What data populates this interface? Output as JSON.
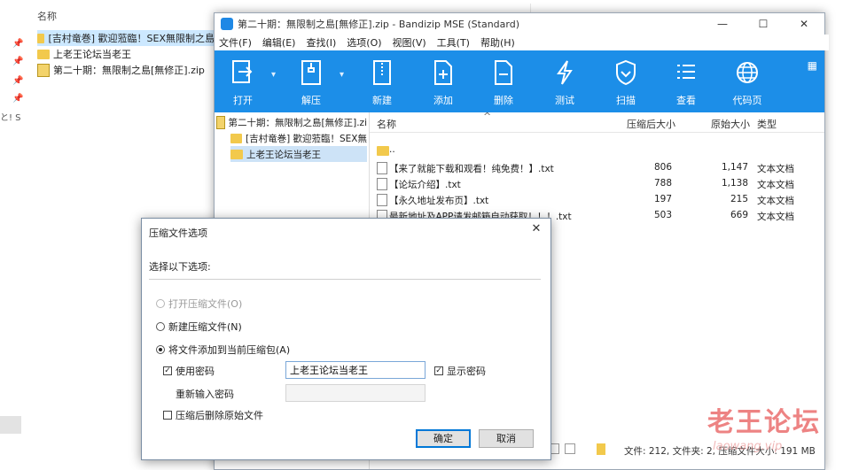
{
  "explorer": {
    "header": "名称",
    "items": [
      {
        "name": "[吉村竜巻] 歡迎蒞臨！SEX無限制之島",
        "type": "folder"
      },
      {
        "name": "上老王论坛当老王",
        "type": "folder"
      },
      {
        "name": "第二十期：無限制之島[無修正].zip",
        "type": "zip"
      }
    ],
    "side_text": "と! S"
  },
  "bandizip": {
    "title": "第二十期：無限制之島[無修正].zip - Bandizip MSE (Standard)",
    "menu": [
      "文件(F)",
      "编辑(E)",
      "查找(I)",
      "选项(O)",
      "视图(V)",
      "工具(T)",
      "帮助(H)"
    ],
    "toolbar": [
      {
        "label": "打开",
        "icon": "open-icon"
      },
      {
        "label": "解压",
        "icon": "extract-icon"
      },
      {
        "label": "新建",
        "icon": "new-archive-icon"
      },
      {
        "label": "添加",
        "icon": "add-file-icon"
      },
      {
        "label": "删除",
        "icon": "delete-file-icon"
      },
      {
        "label": "测试",
        "icon": "test-bolt-icon"
      },
      {
        "label": "扫描",
        "icon": "scan-shield-icon"
      },
      {
        "label": "查看",
        "icon": "view-list-icon"
      },
      {
        "label": "代码页",
        "icon": "codepage-globe-icon"
      }
    ],
    "tree": [
      {
        "name": "第二十期：無限制之島[無修正].zi",
        "level": 0,
        "type": "zip"
      },
      {
        "name": "[吉村竜巻] 歡迎蒞臨！SEX無",
        "level": 1,
        "type": "folder"
      },
      {
        "name": "上老王论坛当老王",
        "level": 1,
        "type": "folder",
        "selected": true
      }
    ],
    "columns": {
      "name": "名称",
      "packed": "压缩后大小",
      "original": "原始大小",
      "type": "类型"
    },
    "files": [
      {
        "name": "..",
        "packed": "",
        "original": "",
        "type": "",
        "kind": "up"
      },
      {
        "name": "【来了就能下载和观看！纯免费！】.txt",
        "packed": "806",
        "original": "1,147",
        "type": "文本文档",
        "kind": "txt"
      },
      {
        "name": "【论坛介绍】.txt",
        "packed": "788",
        "original": "1,138",
        "type": "文本文档",
        "kind": "txt"
      },
      {
        "name": "【永久地址发布页】.txt",
        "packed": "197",
        "original": "215",
        "type": "文本文档",
        "kind": "txt"
      },
      {
        "name": "最新地址及APP请发邮箱自动获取！！！.txt",
        "packed": "503",
        "original": "669",
        "type": "文本文档",
        "kind": "txt"
      }
    ],
    "status": "文件: 212, 文件夹: 2, 压缩文件大小: 191 MB"
  },
  "dialog": {
    "title": "压缩文件选项",
    "prompt": "选择以下选项:",
    "options": [
      {
        "label": "打开压缩文件(O)",
        "checked": false,
        "disabled": true
      },
      {
        "label": "新建压缩文件(N)",
        "checked": false,
        "disabled": false
      },
      {
        "label": "将文件添加到当前压缩包(A)",
        "checked": true,
        "disabled": false
      }
    ],
    "use_password": {
      "label": "使用密码",
      "checked": true
    },
    "password_value": "上老王论坛当老王",
    "show_password": {
      "label": "显示密码",
      "checked": true
    },
    "reenter_label": "重新输入密码",
    "delete_after": {
      "label": "压缩后删除原始文件",
      "checked": false
    },
    "ok": "确定",
    "cancel": "取消"
  },
  "watermark": {
    "main": "老王论坛",
    "sub": "laowang.vip"
  },
  "colors": {
    "toolbar": "#1c8ee8",
    "watermark": "#e85a5a"
  }
}
